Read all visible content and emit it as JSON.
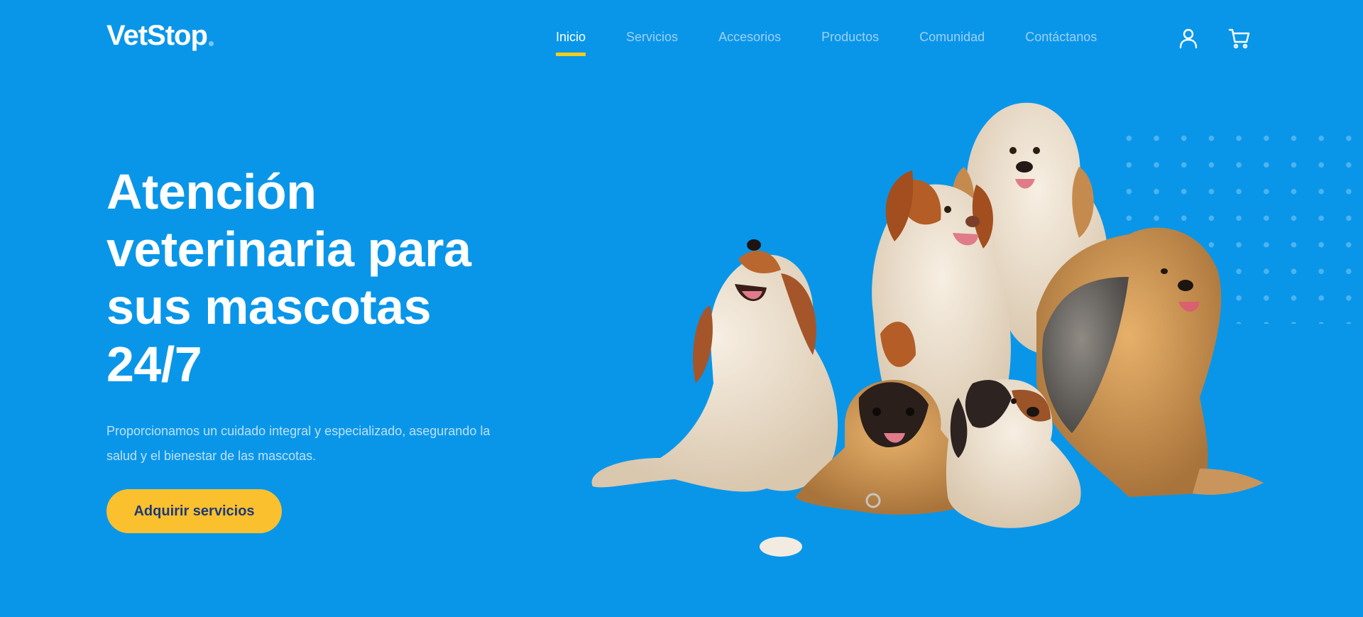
{
  "brand": {
    "name": "VetStop"
  },
  "nav": {
    "items": [
      {
        "label": "Inicio",
        "active": true
      },
      {
        "label": "Servicios",
        "active": false
      },
      {
        "label": "Accesorios",
        "active": false
      },
      {
        "label": "Productos",
        "active": false
      },
      {
        "label": "Comunidad",
        "active": false
      },
      {
        "label": "Contáctanos",
        "active": false
      }
    ]
  },
  "header_icons": [
    "user-icon",
    "cart-icon"
  ],
  "hero": {
    "title_lines": [
      "Atención",
      "veterinaria para",
      "sus mascotas",
      "24/7"
    ],
    "description": "Proporcionamos un cuidado integral y especializado, asegurando la salud y el bienestar de las mascotas.",
    "cta_label": "Adquirir servicios"
  },
  "colors": {
    "background": "#0996e9",
    "accent": "#f4cd1c",
    "button": "#fbc02d",
    "button_text": "#1d3a78",
    "nav_inactive": "#9fd0f6"
  },
  "illustration": "group-of-dogs-image"
}
